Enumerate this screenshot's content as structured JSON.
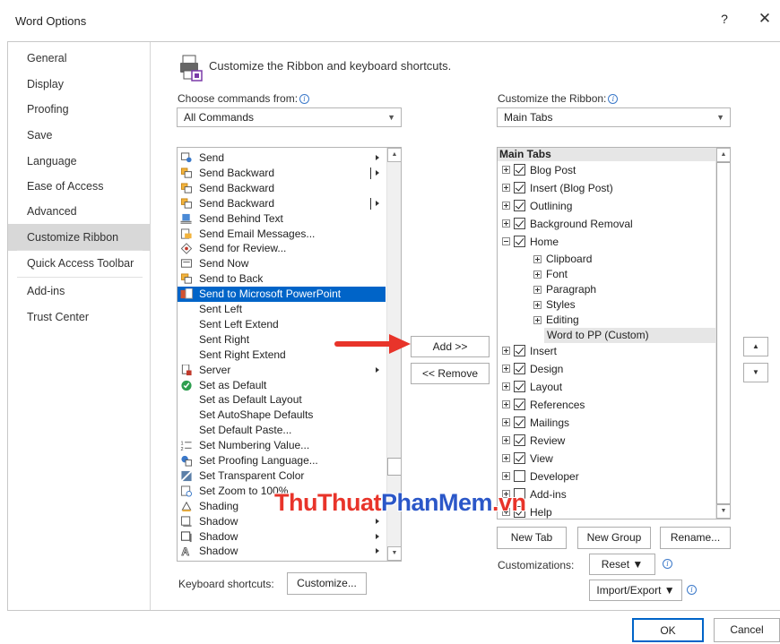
{
  "window": {
    "title": "Word Options",
    "help": "?",
    "close": "✕"
  },
  "nav": {
    "items": [
      {
        "label": "General"
      },
      {
        "label": "Display"
      },
      {
        "label": "Proofing"
      },
      {
        "label": "Save"
      },
      {
        "label": "Language"
      },
      {
        "label": "Ease of Access"
      },
      {
        "label": "Advanced"
      },
      {
        "label": "Customize Ribbon",
        "selected": true
      },
      {
        "label": "Quick Access Toolbar"
      },
      {
        "label": "Add-ins"
      },
      {
        "label": "Trust Center"
      }
    ]
  },
  "header": {
    "title": "Customize the Ribbon and keyboard shortcuts."
  },
  "left": {
    "choose_label": "Choose commands from:",
    "choose_value": "All Commands",
    "commands": [
      {
        "label": "Send",
        "icon": "send-icon",
        "submenu": true
      },
      {
        "label": "Send Backward",
        "icon": "send-backward-icon",
        "split": true
      },
      {
        "label": "Send Backward",
        "icon": "send-backward-icon"
      },
      {
        "label": "Send Backward",
        "icon": "send-backward-icon",
        "split": true
      },
      {
        "label": "Send Behind Text",
        "icon": "send-behind-text-icon"
      },
      {
        "label": "Send Email Messages...",
        "icon": "email-icon"
      },
      {
        "label": "Send for Review...",
        "icon": "review-icon"
      },
      {
        "label": "Send Now",
        "icon": "send-now-icon"
      },
      {
        "label": "Send to Back",
        "icon": "send-to-back-icon"
      },
      {
        "label": "Send to Microsoft PowerPoint",
        "icon": "powerpoint-icon",
        "selected": true
      },
      {
        "label": "Sent Left",
        "icon": ""
      },
      {
        "label": "Sent Left Extend",
        "icon": ""
      },
      {
        "label": "Sent Right",
        "icon": ""
      },
      {
        "label": "Sent Right Extend",
        "icon": ""
      },
      {
        "label": "Server",
        "icon": "server-icon",
        "submenu": true
      },
      {
        "label": "Set as Default",
        "icon": "check-circle-icon"
      },
      {
        "label": "Set as Default Layout",
        "icon": ""
      },
      {
        "label": "Set AutoShape Defaults",
        "icon": ""
      },
      {
        "label": "Set Default Paste...",
        "icon": ""
      },
      {
        "label": "Set Numbering Value...",
        "icon": "numbering-icon"
      },
      {
        "label": "Set Proofing Language...",
        "icon": "language-icon"
      },
      {
        "label": "Set Transparent Color",
        "icon": "transparent-color-icon"
      },
      {
        "label": "Set Zoom to 100%",
        "icon": "zoom-icon"
      },
      {
        "label": "Shading",
        "icon": "shading-icon",
        "submenu": true
      },
      {
        "label": "Shadow",
        "icon": "shadow-icon",
        "submenu": true
      },
      {
        "label": "Shadow",
        "icon": "shadow-box-icon",
        "submenu": true
      },
      {
        "label": "Shadow",
        "icon": "shadow-text-icon",
        "submenu": true
      }
    ],
    "keyboard_label": "Keyboard shortcuts:",
    "customize_button": "Customize..."
  },
  "middle": {
    "add_button": "Add >>",
    "remove_button": "<< Remove"
  },
  "right": {
    "ribbon_label": "Customize the Ribbon:",
    "ribbon_value": "Main Tabs",
    "tree_header": "Main Tabs",
    "tree": [
      {
        "label": "Blog Post",
        "level": 0,
        "expander": "plus",
        "checked": true
      },
      {
        "label": "Insert (Blog Post)",
        "level": 0,
        "expander": "plus",
        "checked": true
      },
      {
        "label": "Outlining",
        "level": 0,
        "expander": "plus",
        "checked": true
      },
      {
        "label": "Background Removal",
        "level": 0,
        "expander": "plus",
        "checked": true
      },
      {
        "label": "Home",
        "level": 0,
        "expander": "minus",
        "checked": true
      },
      {
        "label": "Clipboard",
        "level": 1,
        "expander": "plus"
      },
      {
        "label": "Font",
        "level": 1,
        "expander": "plus"
      },
      {
        "label": "Paragraph",
        "level": 1,
        "expander": "plus"
      },
      {
        "label": "Styles",
        "level": 1,
        "expander": "plus"
      },
      {
        "label": "Editing",
        "level": 1,
        "expander": "plus"
      },
      {
        "label": "Word to PP (Custom)",
        "level": 2,
        "selected": true
      },
      {
        "label": "Insert",
        "level": 0,
        "expander": "plus",
        "checked": true
      },
      {
        "label": "Design",
        "level": 0,
        "expander": "plus",
        "checked": true
      },
      {
        "label": "Layout",
        "level": 0,
        "expander": "plus",
        "checked": true
      },
      {
        "label": "References",
        "level": 0,
        "expander": "plus",
        "checked": true
      },
      {
        "label": "Mailings",
        "level": 0,
        "expander": "plus",
        "checked": true
      },
      {
        "label": "Review",
        "level": 0,
        "expander": "plus",
        "checked": true
      },
      {
        "label": "View",
        "level": 0,
        "expander": "plus",
        "checked": true
      },
      {
        "label": "Developer",
        "level": 0,
        "expander": "plus",
        "checked": false
      },
      {
        "label": "Add-ins",
        "level": 0,
        "expander": "plus",
        "checked": false
      },
      {
        "label": "Help",
        "level": 0,
        "expander": "plus",
        "checked": true
      }
    ],
    "new_tab_button": "New Tab",
    "new_group_button": "New Group",
    "rename_button": "Rename...",
    "customizations_label": "Customizations:",
    "reset_button": "Reset ▼",
    "import_export_button": "Import/Export ▼"
  },
  "footer": {
    "ok_button": "OK",
    "cancel_button": "Cancel"
  },
  "watermark": {
    "part1": "ThuThuat",
    "part2": "PhanMem",
    "part3": ".vn"
  },
  "colors": {
    "selection": "#0064c8",
    "nav_selected": "#d8d8d8",
    "arrow": "#e8342a"
  }
}
